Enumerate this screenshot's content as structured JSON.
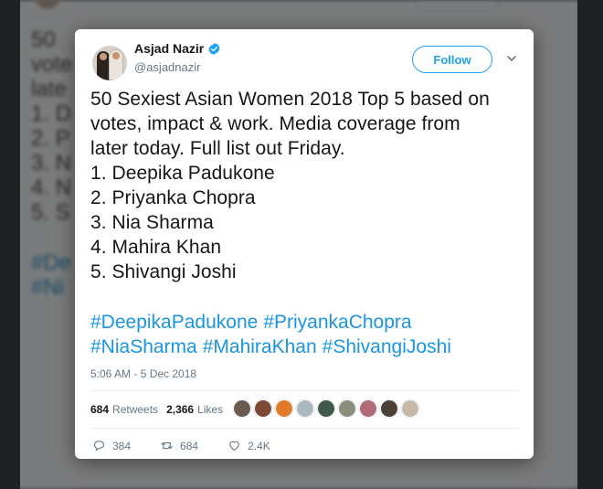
{
  "background": {
    "text_lines": [
      "50",
      "vote",
      "late",
      "1. D",
      "2. P",
      "3. N",
      "4. N",
      "5. S"
    ],
    "tag_lines": [
      "#De",
      "#Ni"
    ]
  },
  "tweet": {
    "author_name": "Asjad Nazir",
    "author_handle": "@asjadnazir",
    "follow_label": "Follow",
    "text_lines": [
      "50 Sexiest Asian Women 2018 Top 5 based on",
      "votes, impact & work. Media coverage from",
      "later today. Full list out Friday.",
      "1. Deepika Padukone",
      "2. Priyanka Chopra",
      "3. Nia Sharma",
      "4. Mahira Khan",
      "5. Shivangi Joshi"
    ],
    "hashtags_line1": [
      "#DeepikaPadukone",
      "#PriyankaChopra"
    ],
    "hashtags_line2": [
      "#NiaSharma",
      "#MahiraKhan",
      "#ShivangiJoshi"
    ],
    "timestamp": "5:06 AM - 5 Dec 2018",
    "retweets_count": "684",
    "retweets_label": "Retweets",
    "likes_count": "2,366",
    "likes_label": "Likes",
    "reply_count": "384",
    "retweet_action_count": "684",
    "like_action_count": "2.4K",
    "liker_colors": [
      "#6b5a50",
      "#7a4a35",
      "#e07b2a",
      "#aab8c2",
      "#3f5a4c",
      "#8a8f7c",
      "#b06a78",
      "#4a4036",
      "#c8b8a8"
    ]
  },
  "colors": {
    "accent": "#1da1f2",
    "hashtag": "#1b95e0",
    "muted": "#657786",
    "text": "#14171a"
  },
  "icons": [
    "verified-icon",
    "chevron-down-icon",
    "reply-icon",
    "retweet-icon",
    "like-icon"
  ]
}
